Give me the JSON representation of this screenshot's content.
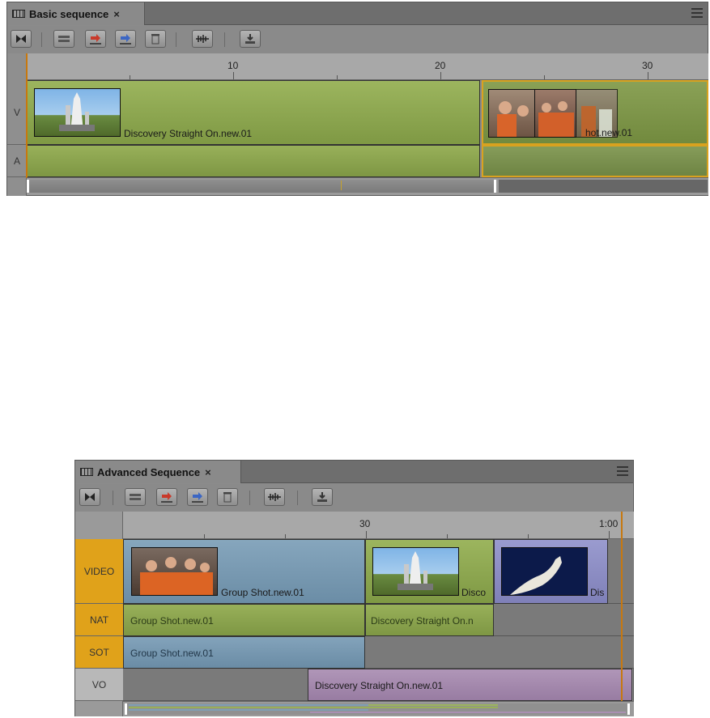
{
  "basic": {
    "tab_title": "Basic sequence",
    "close": "×",
    "ruler": [
      "10",
      "20",
      "30"
    ],
    "tracks": [
      "V",
      "A"
    ],
    "clips": {
      "v1_name": "Discovery Straight On.new.01",
      "v2_name": "hot.new.01"
    }
  },
  "advanced": {
    "tab_title": "Advanced Sequence",
    "close": "×",
    "ruler": [
      "30",
      "1:00"
    ],
    "tracks": [
      "VIDEO",
      "NAT",
      "SOT",
      "VO"
    ],
    "clips": {
      "video1": "Group Shot.new.01",
      "video2": "Disco",
      "video3": "Dis",
      "nat1": "Group Shot.new.01",
      "nat2": "Discovery Straight On.n",
      "sot1": "Group Shot.new.01",
      "vo1": "Discovery Straight On.new.01"
    }
  },
  "colors": {
    "green_clip": "#93aa55",
    "blue_clip": "#7f9fb5",
    "purple_clip": "#a98fb2",
    "lavender_clip": "#8e8fc2",
    "track_label_active": "#e0a21a",
    "playhead": "#c7780f"
  },
  "icons": [
    "timeline-icon",
    "close-icon",
    "panel-menu-icon",
    "monitor-toggle-icon",
    "splice-icon",
    "overwrite-icon",
    "lift-icon",
    "delete-icon",
    "audio-waveform-icon",
    "export-icon"
  ]
}
